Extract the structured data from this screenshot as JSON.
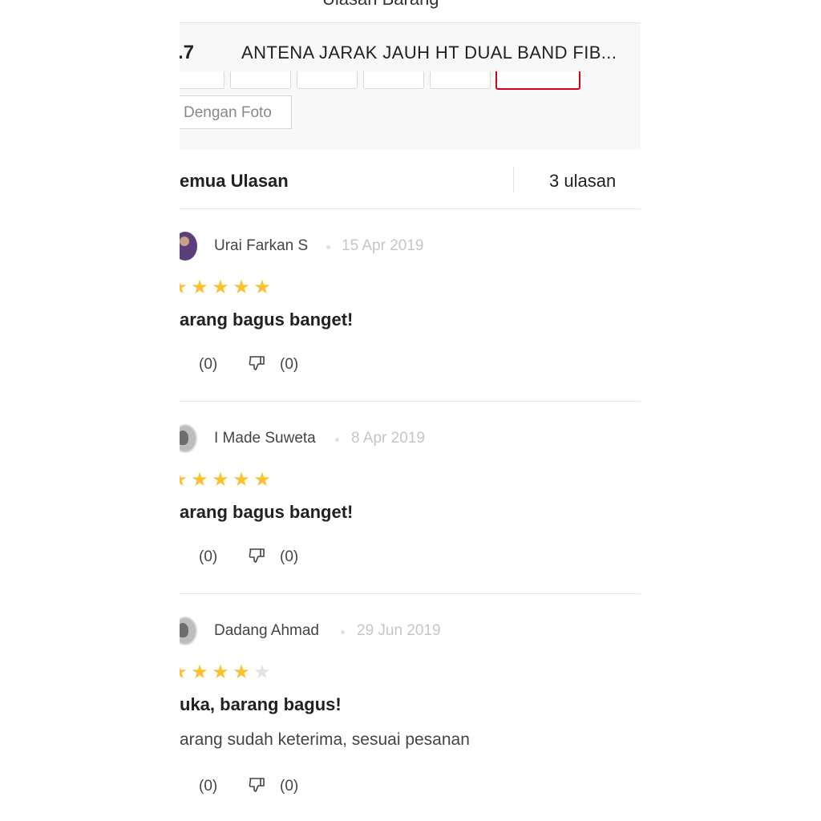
{
  "header": {
    "title": "Ulasan Barang"
  },
  "summary": {
    "rating": ".7",
    "product_name": "ANTENA JARAK JAUH HT DUAL BAND FIB...",
    "filter_photo_label": "Dengan Foto"
  },
  "section": {
    "title": "emua Ulasan",
    "count": "3 ulasan"
  },
  "colors": {
    "star": "#fbc02d",
    "star_off": "#e3e3e3",
    "active_filter": "#d0021b"
  },
  "reviews": [
    {
      "name": "Urai Farkan S",
      "date": "15 Apr 2019",
      "rating": 5,
      "headline": "arang bagus banget!",
      "body": "",
      "likes": "(0)",
      "dislikes": "(0)",
      "avatar": "user-photo"
    },
    {
      "name": "I Made Suweta",
      "date": "8 Apr 2019",
      "rating": 5,
      "headline": "arang bagus banget!",
      "body": "",
      "likes": "(0)",
      "dislikes": "(0)",
      "avatar": "default-avatar"
    },
    {
      "name": "Dadang Ahmad",
      "date": "29 Jun 2019",
      "rating": 4,
      "headline": "uka, barang bagus!",
      "body": "arang sudah keterima, sesuai pesanan",
      "likes": "(0)",
      "dislikes": "(0)",
      "avatar": "default-avatar"
    }
  ]
}
